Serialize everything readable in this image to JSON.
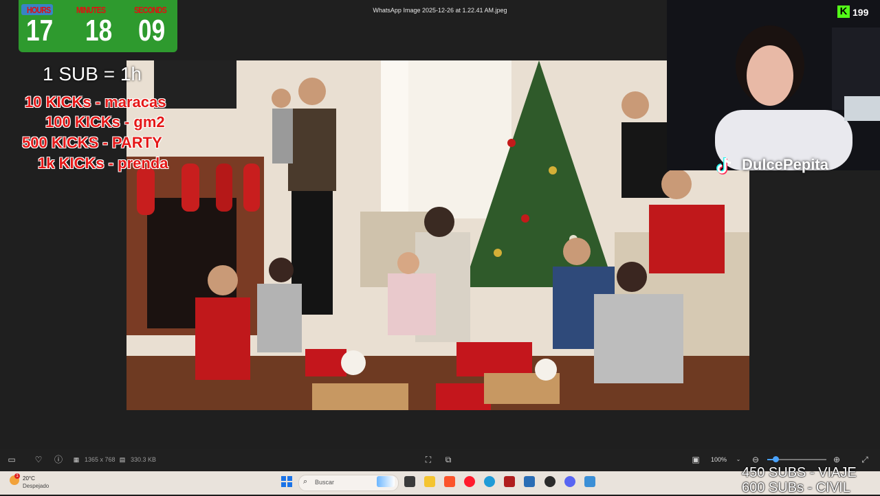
{
  "viewer": {
    "title": "WhatsApp Image 2025-12-26 at 1.22.41 AM.jpeg",
    "dimensions": "1365 x 768",
    "file_size": "330.3 KB",
    "zoom": "100%",
    "zoom_level": 0.14
  },
  "countdown": {
    "hours_label": "HOURS",
    "minutes_label": "MINUTES",
    "seconds_label": "SECONDS",
    "hours": "17",
    "minutes": "18",
    "seconds": "09"
  },
  "goals": {
    "sub_rule": "1 SUB = 1h",
    "items": [
      "10 KICKs - maracas",
      "100 KICKs - gm2",
      "500 KICKS - PARTY",
      "1k KICKs - prenda"
    ],
    "bottom": [
      "450 SUBS - VIAJE",
      "600 SUBs - CIVIL"
    ]
  },
  "stream": {
    "kick_count": "199",
    "tiktok_name": "DulcePepita"
  },
  "taskbar": {
    "weather_temp": "20°C",
    "weather_desc": "Despejado",
    "weather_badge": "1",
    "search_placeholder": "Buscar"
  },
  "colors": {
    "countdown_bg": "#2e9a2e",
    "goal_red": "#e51818",
    "kick_green": "#53fc18",
    "accent_blue": "#4aa3ff"
  }
}
